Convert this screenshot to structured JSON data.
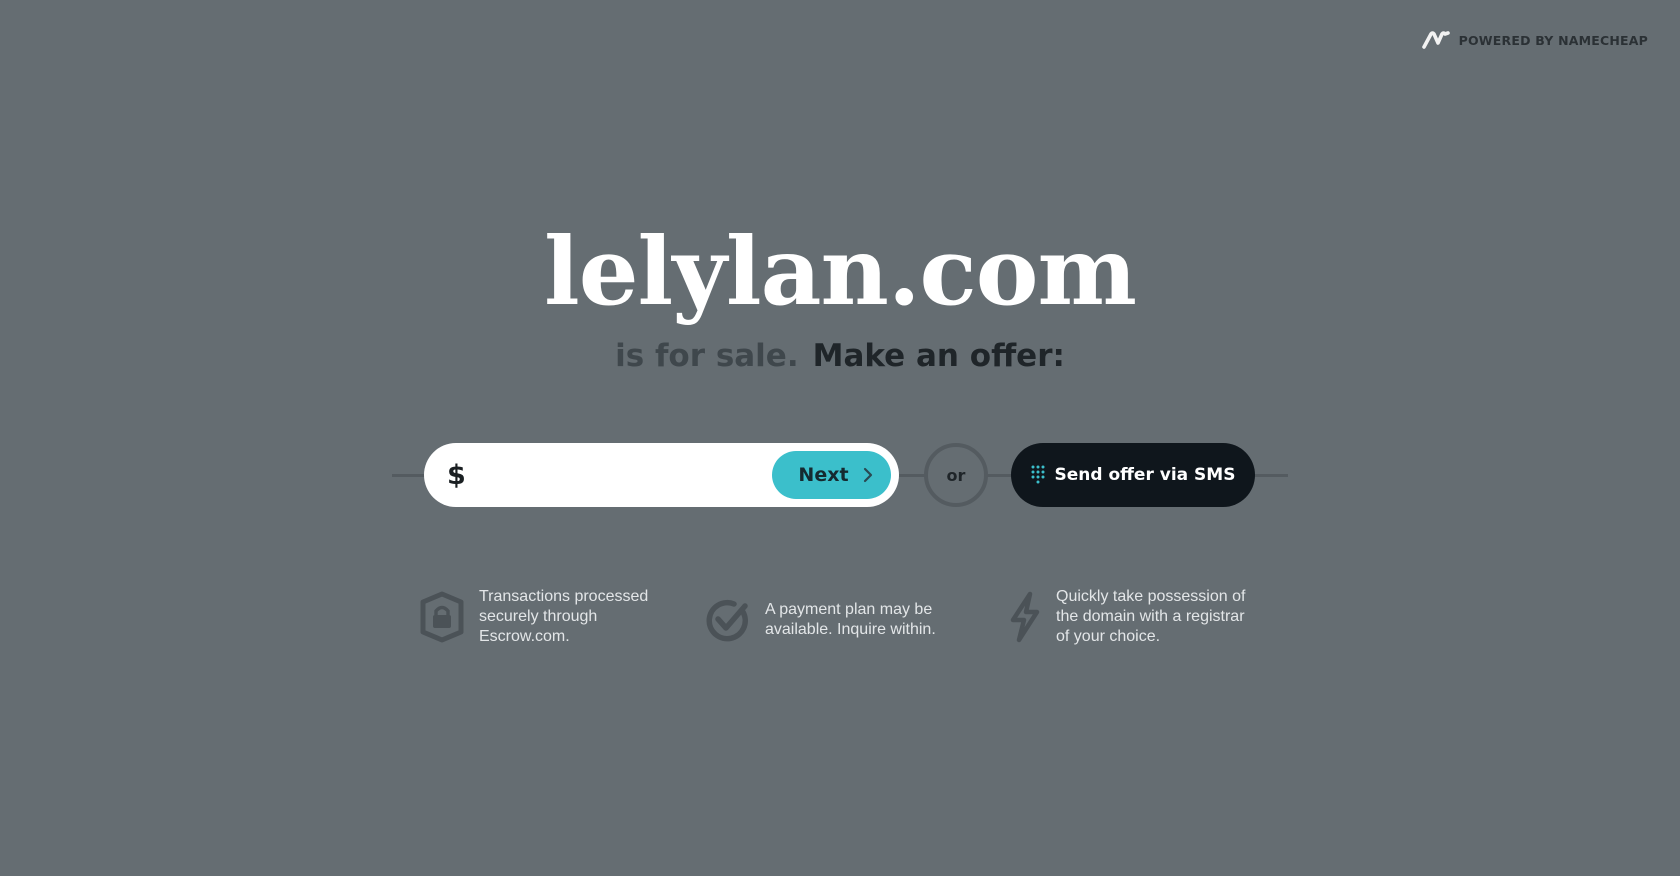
{
  "powered_by": {
    "text": "POWERED BY NAMECHEAP",
    "icon": "namecheap-logo-icon"
  },
  "domain": "lelylan.com",
  "subtitle": {
    "for_sale": "is for sale.",
    "make_offer": "Make an offer:"
  },
  "offer": {
    "currency_symbol": "$",
    "amount_value": "",
    "amount_placeholder": "",
    "next_label": "Next",
    "or_label": "or",
    "sms_label": "Send offer via SMS"
  },
  "features": [
    {
      "icon": "shield-lock-icon",
      "text": "Transactions processed\nsecurely through\nEscrow.com."
    },
    {
      "icon": "checkmark-circle-icon",
      "text": "A payment plan may be\navailable. Inquire within."
    },
    {
      "icon": "lightning-bolt-icon",
      "text": "Quickly take possession of\nthe domain with a registrar\nof your choice."
    }
  ],
  "colors": {
    "background": "#656d72",
    "accent": "#3bbfcb",
    "sms_button": "#0f161c",
    "title": "#ffffff"
  }
}
